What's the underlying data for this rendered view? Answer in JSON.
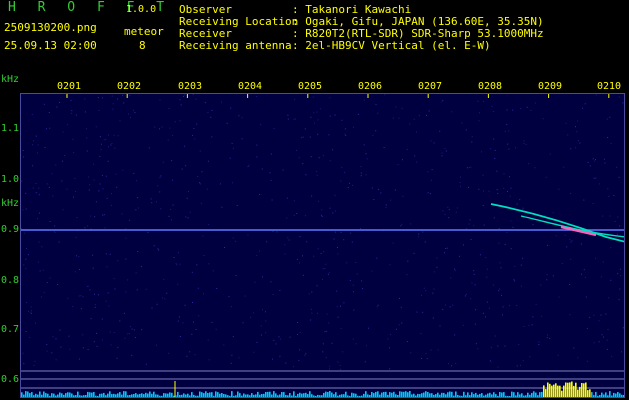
{
  "header": {
    "logo": "H R O F F T",
    "version": "1.0.0",
    "filename": "2509130200.png",
    "datetime": "25.09.13 02:00",
    "meteor_label": "meteor",
    "meteor_count": "8",
    "info_labels": [
      "Observer",
      "Receiving Location",
      "Receiver",
      "Receiving antenna"
    ],
    "info_values": [
      ": Takanori Kawachi",
      ": Ogaki, Gifu, JAPAN (136.60E, 35.35N)",
      ": R820T2(RTL-SDR) SDR-Sharp 53.1000MHz",
      ": 2el-HB9CV Vertical (el. E-W)"
    ]
  },
  "axis": {
    "y_unit_top": "kHz",
    "y_unit_bottom": "kHz",
    "y_ticks": [
      "1.1",
      "1.0",
      "0.9",
      "0.8",
      "0.7",
      "0.6"
    ],
    "x_ticks": [
      "0201",
      "0202",
      "0203",
      "0204",
      "0205",
      "0206",
      "0207",
      "0208",
      "0209",
      "0210"
    ]
  },
  "colors": {
    "plot_bg": "#000040",
    "carrier": "#5a7aff",
    "meteor": "#00e0c0",
    "meteor_hot": "#ff60c0",
    "bars": "#00c8ff",
    "bars_peak": "#ffff00",
    "label_green": "#33cc33",
    "label_yellow": "#ffff00"
  }
}
